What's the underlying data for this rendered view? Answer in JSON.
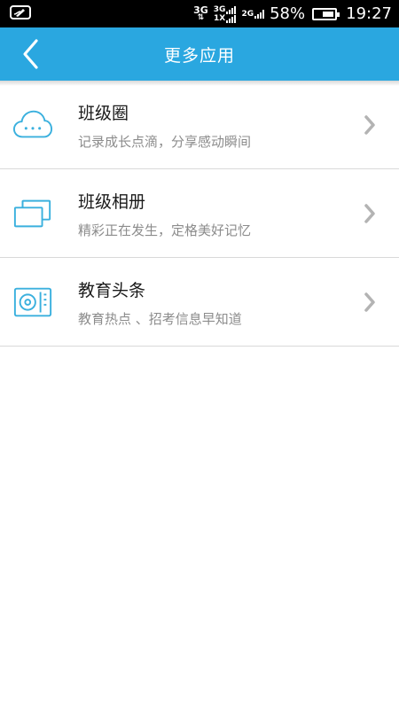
{
  "status_bar": {
    "network_primary": "3G",
    "network_secondary_top": "3G",
    "network_secondary_bottom": "1X",
    "network_tertiary": "2G",
    "battery_percent": "58%",
    "battery_level": 0.58,
    "time": "19:27",
    "icons": [
      "notification-icon",
      "data-transfer-icon",
      "signal-icon",
      "battery-icon"
    ]
  },
  "header": {
    "title": "更多应用",
    "back_icon": "chevron-left-icon"
  },
  "colors": {
    "accent": "#2aa7e0",
    "icon_blue": "#3ab0de",
    "chevron_gray": "#b3b3b3",
    "subtitle_gray": "#8c8c8c"
  },
  "apps": [
    {
      "title": "班级圈",
      "subtitle": "记录成长点滴，分享感动瞬间",
      "icon": "cloud-icon"
    },
    {
      "title": "班级相册",
      "subtitle": "精彩正在发生，定格美好记忆",
      "icon": "photo-album-icon"
    },
    {
      "title": "教育头条",
      "subtitle": "教育热点 、招考信息早知道",
      "icon": "news-icon"
    }
  ]
}
